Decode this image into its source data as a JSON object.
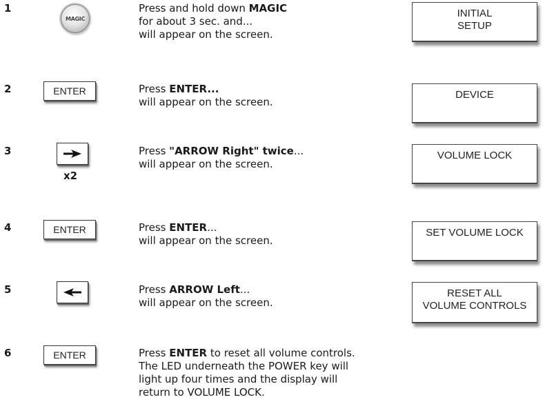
{
  "steps": [
    {
      "number": "1",
      "button": "MAGIC",
      "text": [
        {
          "plain": "Press and hold down ",
          "bold": "MAGIC",
          "after": ""
        },
        "for about 3 sec. and...",
        "will appear on the screen."
      ],
      "screen": [
        "INITIAL",
        "SETUP"
      ]
    },
    {
      "number": "2",
      "button": "ENTER",
      "line1_plain": "Press ",
      "line1_bold": "ENTER...",
      "line1_after": "",
      "line2": "will appear on the screen.",
      "screen": [
        "DEVICE"
      ]
    },
    {
      "number": "3",
      "button_icon": "arrow-right-icon",
      "multiplier": "x2",
      "line1_plain": "Press ",
      "line1_bold": "\"ARROW Right\" twice",
      "line1_after": "...",
      "line2": "will appear on the screen.",
      "screen": [
        "VOLUME LOCK"
      ]
    },
    {
      "number": "4",
      "button": "ENTER",
      "line1_plain": "Press ",
      "line1_bold": "ENTER",
      "line1_after": "...",
      "line2": "will appear on the screen.",
      "screen": [
        "SET VOLUME LOCK"
      ]
    },
    {
      "number": "5",
      "button_icon": "arrow-left-icon",
      "line1_plain": "Press ",
      "line1_bold": "ARROW Left",
      "line1_after": "...",
      "line2": "will appear on the screen.",
      "screen": [
        "RESET ALL",
        "VOLUME CONTROLS"
      ]
    },
    {
      "number": "6",
      "button": "ENTER",
      "line1_plain": "Press ",
      "line1_bold": "ENTER",
      "line1_after": " to reset all volume controls.",
      "line2": "The LED underneath the POWER key will",
      "line3": "light up four times and the display will",
      "line4": "return to VOLUME LOCK."
    }
  ]
}
